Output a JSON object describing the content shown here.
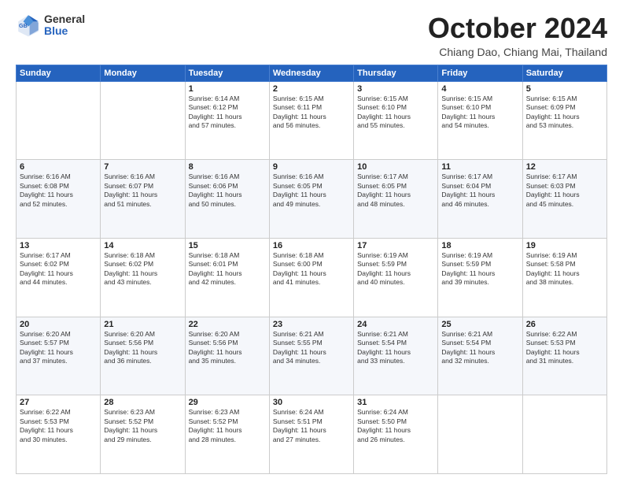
{
  "header": {
    "logo_general": "General",
    "logo_blue": "Blue",
    "month_title": "October 2024",
    "subtitle": "Chiang Dao, Chiang Mai, Thailand"
  },
  "weekdays": [
    "Sunday",
    "Monday",
    "Tuesday",
    "Wednesday",
    "Thursday",
    "Friday",
    "Saturday"
  ],
  "weeks": [
    [
      {
        "day": "",
        "info": ""
      },
      {
        "day": "",
        "info": ""
      },
      {
        "day": "1",
        "info": "Sunrise: 6:14 AM\nSunset: 6:12 PM\nDaylight: 11 hours\nand 57 minutes."
      },
      {
        "day": "2",
        "info": "Sunrise: 6:15 AM\nSunset: 6:11 PM\nDaylight: 11 hours\nand 56 minutes."
      },
      {
        "day": "3",
        "info": "Sunrise: 6:15 AM\nSunset: 6:10 PM\nDaylight: 11 hours\nand 55 minutes."
      },
      {
        "day": "4",
        "info": "Sunrise: 6:15 AM\nSunset: 6:10 PM\nDaylight: 11 hours\nand 54 minutes."
      },
      {
        "day": "5",
        "info": "Sunrise: 6:15 AM\nSunset: 6:09 PM\nDaylight: 11 hours\nand 53 minutes."
      }
    ],
    [
      {
        "day": "6",
        "info": "Sunrise: 6:16 AM\nSunset: 6:08 PM\nDaylight: 11 hours\nand 52 minutes."
      },
      {
        "day": "7",
        "info": "Sunrise: 6:16 AM\nSunset: 6:07 PM\nDaylight: 11 hours\nand 51 minutes."
      },
      {
        "day": "8",
        "info": "Sunrise: 6:16 AM\nSunset: 6:06 PM\nDaylight: 11 hours\nand 50 minutes."
      },
      {
        "day": "9",
        "info": "Sunrise: 6:16 AM\nSunset: 6:05 PM\nDaylight: 11 hours\nand 49 minutes."
      },
      {
        "day": "10",
        "info": "Sunrise: 6:17 AM\nSunset: 6:05 PM\nDaylight: 11 hours\nand 48 minutes."
      },
      {
        "day": "11",
        "info": "Sunrise: 6:17 AM\nSunset: 6:04 PM\nDaylight: 11 hours\nand 46 minutes."
      },
      {
        "day": "12",
        "info": "Sunrise: 6:17 AM\nSunset: 6:03 PM\nDaylight: 11 hours\nand 45 minutes."
      }
    ],
    [
      {
        "day": "13",
        "info": "Sunrise: 6:17 AM\nSunset: 6:02 PM\nDaylight: 11 hours\nand 44 minutes."
      },
      {
        "day": "14",
        "info": "Sunrise: 6:18 AM\nSunset: 6:02 PM\nDaylight: 11 hours\nand 43 minutes."
      },
      {
        "day": "15",
        "info": "Sunrise: 6:18 AM\nSunset: 6:01 PM\nDaylight: 11 hours\nand 42 minutes."
      },
      {
        "day": "16",
        "info": "Sunrise: 6:18 AM\nSunset: 6:00 PM\nDaylight: 11 hours\nand 41 minutes."
      },
      {
        "day": "17",
        "info": "Sunrise: 6:19 AM\nSunset: 5:59 PM\nDaylight: 11 hours\nand 40 minutes."
      },
      {
        "day": "18",
        "info": "Sunrise: 6:19 AM\nSunset: 5:59 PM\nDaylight: 11 hours\nand 39 minutes."
      },
      {
        "day": "19",
        "info": "Sunrise: 6:19 AM\nSunset: 5:58 PM\nDaylight: 11 hours\nand 38 minutes."
      }
    ],
    [
      {
        "day": "20",
        "info": "Sunrise: 6:20 AM\nSunset: 5:57 PM\nDaylight: 11 hours\nand 37 minutes."
      },
      {
        "day": "21",
        "info": "Sunrise: 6:20 AM\nSunset: 5:56 PM\nDaylight: 11 hours\nand 36 minutes."
      },
      {
        "day": "22",
        "info": "Sunrise: 6:20 AM\nSunset: 5:56 PM\nDaylight: 11 hours\nand 35 minutes."
      },
      {
        "day": "23",
        "info": "Sunrise: 6:21 AM\nSunset: 5:55 PM\nDaylight: 11 hours\nand 34 minutes."
      },
      {
        "day": "24",
        "info": "Sunrise: 6:21 AM\nSunset: 5:54 PM\nDaylight: 11 hours\nand 33 minutes."
      },
      {
        "day": "25",
        "info": "Sunrise: 6:21 AM\nSunset: 5:54 PM\nDaylight: 11 hours\nand 32 minutes."
      },
      {
        "day": "26",
        "info": "Sunrise: 6:22 AM\nSunset: 5:53 PM\nDaylight: 11 hours\nand 31 minutes."
      }
    ],
    [
      {
        "day": "27",
        "info": "Sunrise: 6:22 AM\nSunset: 5:53 PM\nDaylight: 11 hours\nand 30 minutes."
      },
      {
        "day": "28",
        "info": "Sunrise: 6:23 AM\nSunset: 5:52 PM\nDaylight: 11 hours\nand 29 minutes."
      },
      {
        "day": "29",
        "info": "Sunrise: 6:23 AM\nSunset: 5:52 PM\nDaylight: 11 hours\nand 28 minutes."
      },
      {
        "day": "30",
        "info": "Sunrise: 6:24 AM\nSunset: 5:51 PM\nDaylight: 11 hours\nand 27 minutes."
      },
      {
        "day": "31",
        "info": "Sunrise: 6:24 AM\nSunset: 5:50 PM\nDaylight: 11 hours\nand 26 minutes."
      },
      {
        "day": "",
        "info": ""
      },
      {
        "day": "",
        "info": ""
      }
    ]
  ]
}
